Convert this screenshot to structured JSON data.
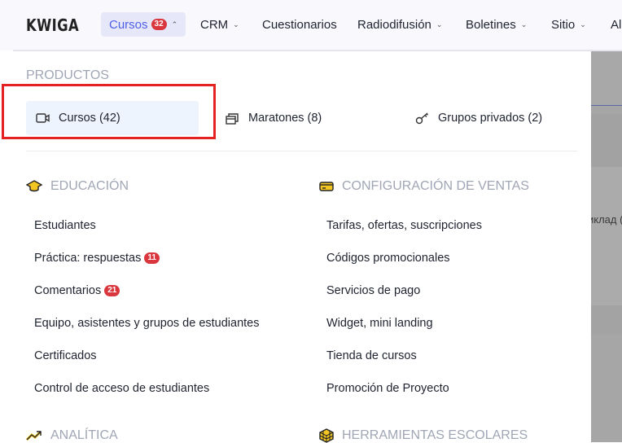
{
  "header": {
    "logo": "KWIGA",
    "nav": [
      {
        "label": "Cursos",
        "badge": "32"
      },
      {
        "label": "CRM"
      },
      {
        "label": "Cuestionarios"
      },
      {
        "label": "Radiodifusión"
      },
      {
        "label": "Boletines"
      },
      {
        "label": "Sitio"
      },
      {
        "label": "Al"
      }
    ]
  },
  "products": {
    "title": "PRODUCTOS",
    "items": [
      {
        "label": "Cursos (42)"
      },
      {
        "label": "Maratones (8)"
      },
      {
        "label": "Grupos privados (2)"
      }
    ]
  },
  "education": {
    "title": "EDUCACIÓN",
    "items": [
      {
        "label": "Estudiantes"
      },
      {
        "label": "Práctica: respuestas",
        "badge": "11"
      },
      {
        "label": "Comentarios",
        "badge": "21"
      },
      {
        "label": "Equipo, asistentes y grupos de estudiantes"
      },
      {
        "label": "Certificados"
      },
      {
        "label": "Control de acceso de estudiantes"
      }
    ]
  },
  "sales": {
    "title": "CONFIGURACIÓN DE VENTAS",
    "items": [
      {
        "label": "Tarifas, ofertas, suscripciones"
      },
      {
        "label": "Códigos promocionales"
      },
      {
        "label": "Servicios de pago"
      },
      {
        "label": "Widget, mini landing"
      },
      {
        "label": "Tienda de cursos"
      },
      {
        "label": "Promoción de Proyecto"
      }
    ]
  },
  "analytics": {
    "title": "ANALÍTICA"
  },
  "tools": {
    "title": "HERRAMIENTAS ESCOLARES"
  },
  "background": {
    "snippet": "иклад ("
  }
}
